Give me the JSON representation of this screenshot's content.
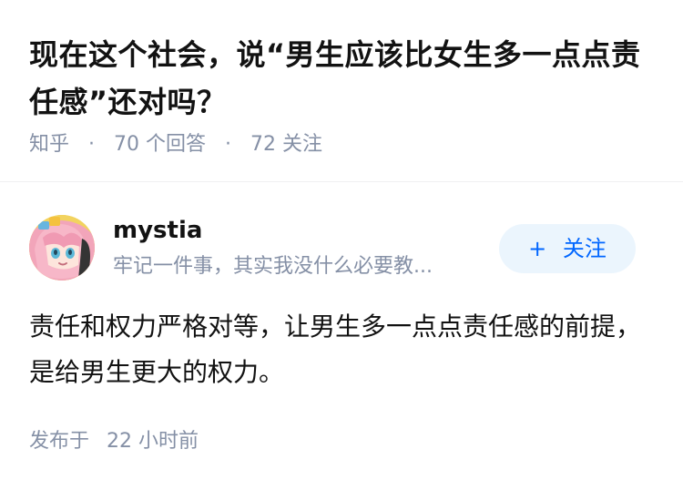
{
  "question": {
    "title": "现在这个社会，说“男生应该比女生多一点点责任感”还对吗？",
    "source": "知乎",
    "separator": "·",
    "answers_count": "70",
    "answers_label": "个回答",
    "followers_count": "72",
    "followers_label": "关注"
  },
  "answer": {
    "author": {
      "avatar_icon": "anime-girl-avatar",
      "name": "mystia",
      "headline": "牢记一件事，其实我没什么必要教..."
    },
    "follow_button": {
      "icon": "+",
      "label": "关注"
    },
    "content": "责任和权力严格对等，让男生多一点点责任感的前提，是给男生更大的权力。",
    "time": {
      "label": "发布于",
      "value": "22 小时前"
    }
  },
  "colors": {
    "title": "#121212",
    "meta": "#8590a6",
    "brand_blue": "#0066ff",
    "follow_bg": "#ebf5fd",
    "divider": "#f0f0f2"
  }
}
